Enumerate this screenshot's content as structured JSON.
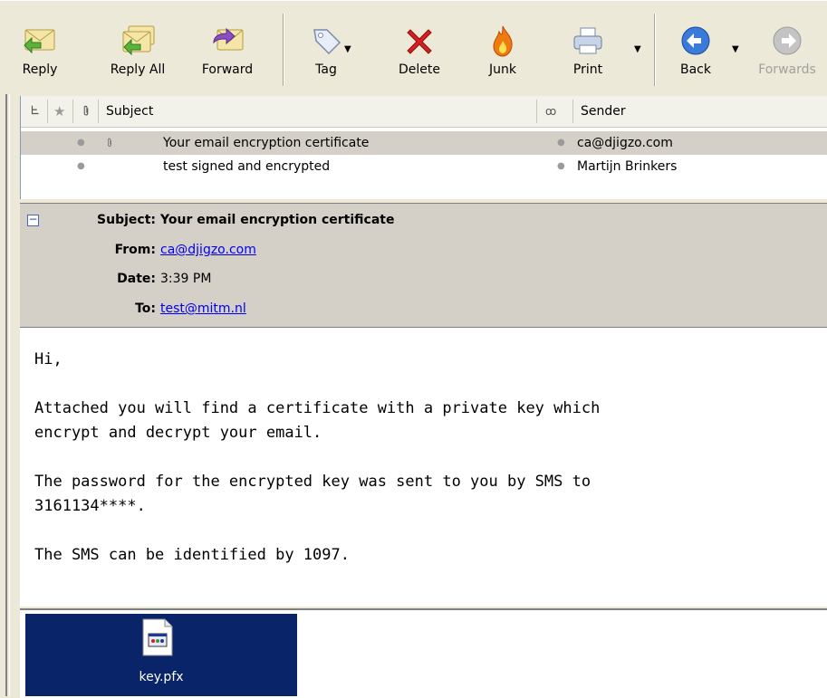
{
  "toolbar": {
    "reply": "Reply",
    "reply_all": "Reply All",
    "forward": "Forward",
    "tag": "Tag",
    "delete": "Delete",
    "junk": "Junk",
    "print": "Print",
    "back": "Back",
    "forwards": "Forwards"
  },
  "thread": {
    "columns": {
      "subject": "Subject",
      "sender": "Sender"
    },
    "rows": [
      {
        "subject": "Your email encryption certificate",
        "sender": "ca@djigzo.com",
        "has_attachment": true
      },
      {
        "subject": "test signed and encrypted",
        "sender": "Martijn Brinkers",
        "has_attachment": false
      }
    ]
  },
  "header": {
    "subject_label": "Subject:",
    "subject": "Your email encryption certificate",
    "from_label": "From:",
    "from": "ca@djigzo.com",
    "date_label": "Date:",
    "date": "3:39 PM",
    "to_label": "To:",
    "to": "test@mitm.nl"
  },
  "body": {
    "text": "Hi,\n\nAttached you will find a certificate with a private key which\nencrypt and decrypt your email.\n\nThe password for the encrypted key was sent to you by SMS to\n3161134****.\n\nThe SMS can be identified by 1097."
  },
  "attachment": {
    "name": "key.pfx"
  },
  "colors": {
    "link": "#0000ee",
    "selection": "#0a246a",
    "delete_red": "#d42020",
    "toolbar_bg": "#ece9d8"
  }
}
